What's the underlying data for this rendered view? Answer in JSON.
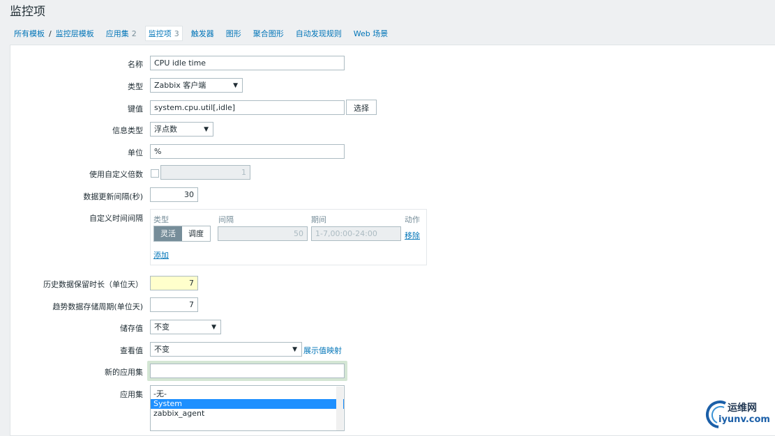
{
  "page": {
    "title": "监控项"
  },
  "nav": {
    "all_templates": "所有模板",
    "separator": "/",
    "host": "监控层模板",
    "tabs": [
      {
        "label": "应用集",
        "count": "2"
      },
      {
        "label": "监控项",
        "count": "3"
      },
      {
        "label": "触发器",
        "count": ""
      },
      {
        "label": "图形",
        "count": ""
      },
      {
        "label": "聚合图形",
        "count": ""
      },
      {
        "label": "自动发现规则",
        "count": ""
      },
      {
        "label": "Web 场景",
        "count": ""
      }
    ]
  },
  "form": {
    "name": {
      "label": "名称",
      "value": "CPU idle time"
    },
    "type": {
      "label": "类型",
      "value": "Zabbix 客户端"
    },
    "key": {
      "label": "键值",
      "value": "system.cpu.util[,idle]",
      "button": "选择"
    },
    "info_type": {
      "label": "信息类型",
      "value": "浮点数"
    },
    "units": {
      "label": "单位",
      "value": "%"
    },
    "multiplier": {
      "label": "使用自定义倍数",
      "value": "1",
      "checked": false
    },
    "update_interval": {
      "label": "数据更新间隔(秒)",
      "value": "30"
    },
    "custom_intervals": {
      "label": "自定义时间间隔",
      "headers": {
        "type": "类型",
        "interval": "间隔",
        "period": "期间",
        "action": "动作"
      },
      "row": {
        "flexible": "灵活",
        "scheduling": "调度",
        "interval": "50",
        "period": "1-7,00:00-24:00",
        "remove": "移除"
      },
      "add": "添加"
    },
    "history": {
      "label": "历史数据保留时长（单位天）",
      "value": "7"
    },
    "trends": {
      "label": "趋势数据存储周期(单位天)",
      "value": "7"
    },
    "store_value": {
      "label": "储存值",
      "value": "不变"
    },
    "show_value": {
      "label": "查看值",
      "value": "不变",
      "link": "展示值映射"
    },
    "new_application": {
      "label": "新的应用集",
      "value": ""
    },
    "applications": {
      "label": "应用集",
      "options": [
        "-无-",
        "System",
        "zabbix_agent"
      ],
      "selected": "System"
    }
  },
  "watermark": {
    "line1": "运维网",
    "line2": "iyunv.com"
  }
}
